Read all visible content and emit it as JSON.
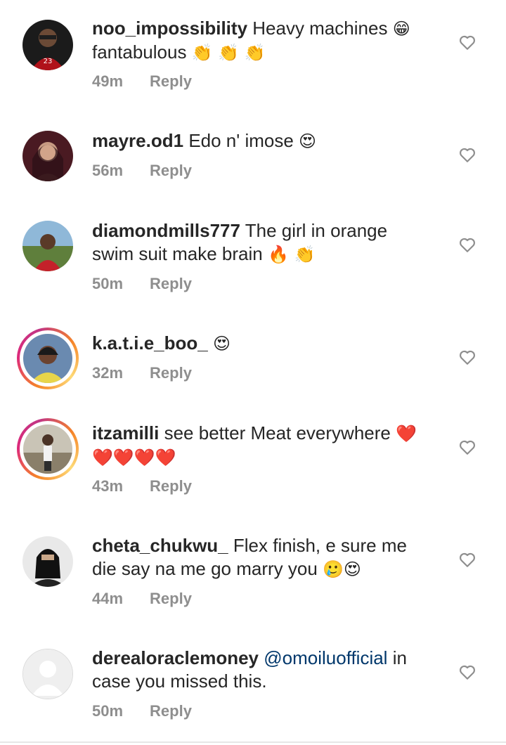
{
  "comments": [
    {
      "username": "noo_impossibility",
      "text": "Heavy machines",
      "emoji_inline": "😁",
      "line2": "fantabulous",
      "line2_emoji": "👏 👏 👏",
      "time": "49m",
      "reply": "Reply"
    },
    {
      "username": "mayre.od1",
      "text": "Edo n' imose",
      "emoji_inline": "😍",
      "time": "56m",
      "reply": "Reply"
    },
    {
      "username": "diamondmills777",
      "text": "The girl in orange",
      "line2": "swim suit make brain",
      "line2_emoji": "🔥 👏",
      "time": "50m",
      "reply": "Reply"
    },
    {
      "username": "k.a.t.i.e_boo_",
      "emoji_inline": "😍",
      "time": "32m",
      "reply": "Reply"
    },
    {
      "username": "itzamilli",
      "text": "see better Meat everywhere",
      "emoji_inline": "❤️",
      "line2_emoji": "❤️❤️❤️❤️",
      "time": "43m",
      "reply": "Reply"
    },
    {
      "username": "cheta_chukwu_",
      "text": "Flex finish,  e sure me",
      "line2": "die say na me go marry you",
      "line2_emoji": "🥲😍",
      "time": "44m",
      "reply": "Reply"
    },
    {
      "username": "derealoraclemoney",
      "mention": "@omoiluofficial",
      "text": "in",
      "line2": "case you missed this.",
      "time": "50m",
      "reply": "Reply"
    }
  ],
  "icons": {
    "like": "heart-outline-icon"
  },
  "colors": {
    "meta": "#8e8e8e",
    "mention": "#00376b",
    "story_ring": "#dd2a7b"
  }
}
